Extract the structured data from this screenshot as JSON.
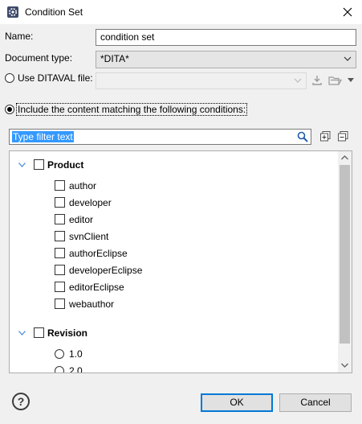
{
  "window": {
    "title": "Condition Set"
  },
  "form": {
    "name_label": "Name:",
    "name_value": "condition set",
    "doctype_label": "Document type:",
    "doctype_value": "*DITA*",
    "ditaval_label": "Use DITAVAL file:",
    "ditaval_value": "",
    "include_label": "Include the content matching the following conditions:"
  },
  "filter": {
    "placeholder": "Type filter text",
    "value": "Type filter text"
  },
  "tree": {
    "groups": [
      {
        "label": "Product",
        "items": [
          "author",
          "developer",
          "editor",
          "svnClient",
          "authorEclipse",
          "developerEclipse",
          "editorEclipse",
          "webauthor"
        ]
      },
      {
        "label": "Revision",
        "items": [
          "1.0",
          "2.0"
        ]
      }
    ]
  },
  "buttons": {
    "ok": "OK",
    "cancel": "Cancel",
    "help": "?"
  },
  "colors": {
    "accent": "#0078d7",
    "selection": "#3399ff",
    "twisty": "#4a90d9",
    "search_icon": "#1e5aa8"
  }
}
